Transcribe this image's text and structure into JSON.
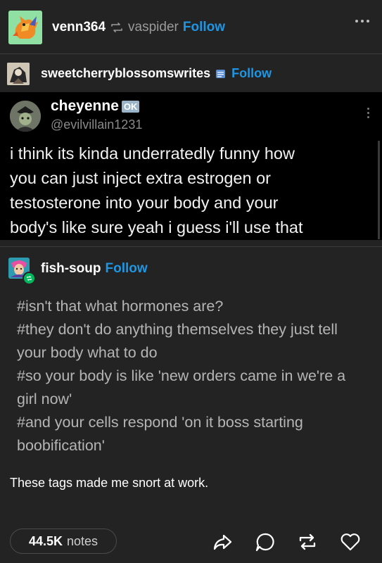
{
  "header": {
    "username": "venn364",
    "reblogged_from": "vaspider",
    "follow_label": "Follow"
  },
  "reblog_user": {
    "username": "sweetcherryblossomswrites",
    "follow_label": "Follow"
  },
  "tweet": {
    "display_name": "cheyenne",
    "badge": "OK",
    "handle": "@evilvillain1231",
    "lines": [
      "i think its kinda underratedly funny how",
      "you can just inject extra estrogen or",
      "testosterone into your body and your",
      "body's like sure yeah i guess i'll use that"
    ]
  },
  "fish_soup": {
    "username": "fish-soup",
    "follow_label": "Follow",
    "tags": [
      "#isn't that what hormones are?",
      "#they don't do anything themselves they just tell your body what to do",
      "#so your body is like 'new orders came in we're a girl now'",
      "#and your cells respond 'on it boss starting boobification'"
    ]
  },
  "comment": "These tags made me snort at work.",
  "footer": {
    "notes_count": "44.5K",
    "notes_label": "notes"
  },
  "icons": {
    "share": "share-icon",
    "reply": "reply-icon",
    "reblog": "reblog-icon",
    "like": "heart-icon"
  },
  "colors": {
    "background": "#232323",
    "accent": "#1e96e3",
    "tweet_bg": "#000000"
  }
}
